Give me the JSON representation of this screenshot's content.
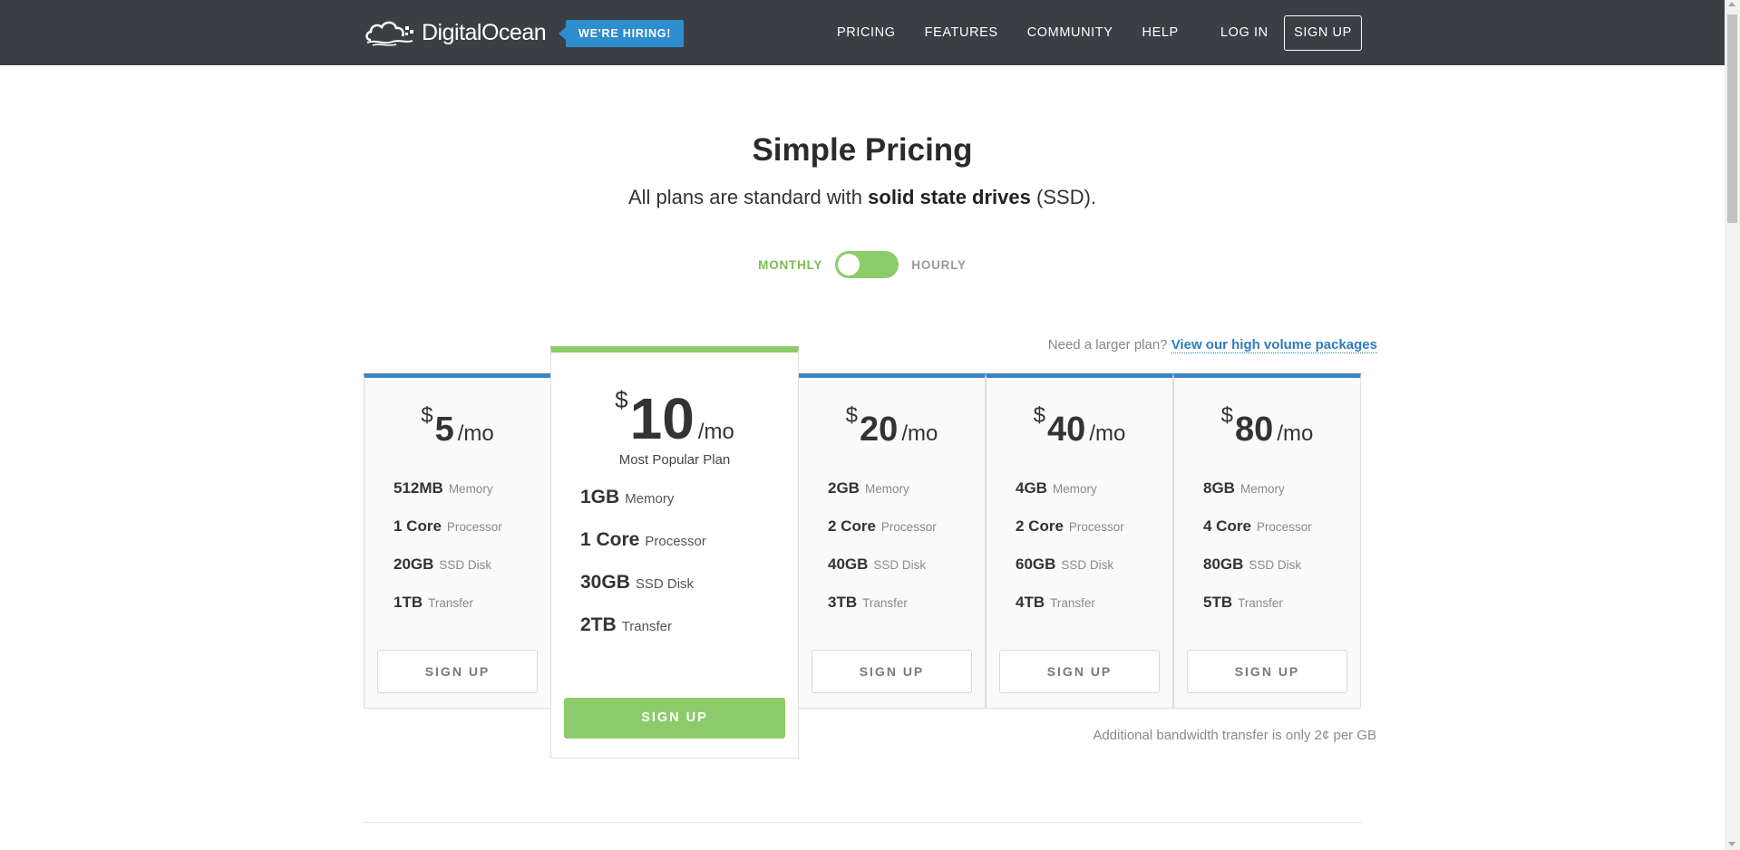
{
  "nav": {
    "logo_text": "DigitalOcean",
    "hiring_badge": "WE'RE HIRING!",
    "links": [
      "PRICING",
      "FEATURES",
      "COMMUNITY",
      "HELP"
    ],
    "login": "LOG IN",
    "signup": "SIGN UP"
  },
  "hero": {
    "title": "Simple Pricing",
    "subtitle_prefix": "All plans are standard with",
    "subtitle_bold": "solid state drives",
    "subtitle_suffix": "(SSD)."
  },
  "billing_toggle": {
    "left": "MONTHLY",
    "right": "HOURLY",
    "selected": "MONTHLY"
  },
  "larger_plan": {
    "prefix": "Need a larger plan?",
    "link": "View our high volume packages"
  },
  "plans": [
    {
      "currency": "$",
      "price": "5",
      "period": "/mo",
      "tag": "",
      "memory": "512MB",
      "processor": "1 Core",
      "disk": "20GB",
      "transfer": "1TB",
      "button": "SIGN UP"
    },
    {
      "currency": "$",
      "price": "10",
      "period": "/mo",
      "tag": "Most Popular Plan",
      "memory": "1GB",
      "processor": "1 Core",
      "disk": "30GB",
      "transfer": "2TB",
      "button": "SIGN UP"
    },
    {
      "currency": "$",
      "price": "20",
      "period": "/mo",
      "tag": "",
      "memory": "2GB",
      "processor": "2 Core",
      "disk": "40GB",
      "transfer": "3TB",
      "button": "SIGN UP"
    },
    {
      "currency": "$",
      "price": "40",
      "period": "/mo",
      "tag": "",
      "memory": "4GB",
      "processor": "2 Core",
      "disk": "60GB",
      "transfer": "4TB",
      "button": "SIGN UP"
    },
    {
      "currency": "$",
      "price": "80",
      "period": "/mo",
      "tag": "",
      "memory": "8GB",
      "processor": "4 Core",
      "disk": "80GB",
      "transfer": "5TB",
      "button": "SIGN UP"
    }
  ],
  "spec_labels": {
    "memory": "Memory",
    "processor": "Processor",
    "disk": "SSD Disk",
    "transfer": "Transfer"
  },
  "bandwidth_note": "Additional bandwidth transfer is only 2¢ per GB",
  "colors": {
    "nav_bg": "#3a3f44",
    "accent_blue": "#3c86c3",
    "accent_green": "#8ccb6a",
    "hiring_blue": "#2f8dcd"
  }
}
